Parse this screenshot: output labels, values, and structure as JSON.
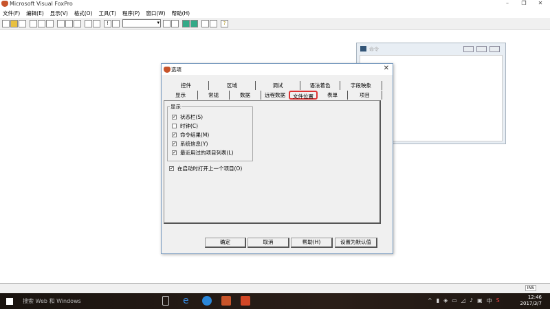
{
  "app": {
    "title": "Microsoft Visual FoxPro"
  },
  "menu": [
    "文件(F)",
    "编辑(E)",
    "显示(V)",
    "格式(O)",
    "工具(T)",
    "程序(P)",
    "窗口(W)",
    "帮助(H)"
  ],
  "command_window": {
    "title": "命令"
  },
  "dialog": {
    "title": "选项",
    "tabs_row1": [
      "控件",
      "区域",
      "调试",
      "语法着色",
      "字段映象"
    ],
    "tabs_row2": [
      "显示",
      "常规",
      "数据",
      "远程数据",
      "文件位置",
      "表单",
      "项目"
    ],
    "selected_tab": "文件位置",
    "group_label": "显示",
    "checkboxes": [
      {
        "label": "状态栏(S)",
        "checked": true
      },
      {
        "label": "时钟(C)",
        "checked": false
      },
      {
        "label": "命令结果(M)",
        "checked": true
      },
      {
        "label": "系统信息(Y)",
        "checked": true
      },
      {
        "label": "最近用过的项目列表(L)",
        "checked": true
      }
    ],
    "startup_checkbox": {
      "label": "在启动时打开上一个项目(O)",
      "checked": true
    },
    "buttons": {
      "ok": "确定",
      "cancel": "取消",
      "help": "帮助(H)",
      "default": "设置为默认值"
    }
  },
  "statusbar": {
    "indicator": "INS"
  },
  "taskbar": {
    "search": "搜索 Web 和 Windows",
    "time": "12:46",
    "date": "2017/3/7",
    "ime": "中"
  }
}
